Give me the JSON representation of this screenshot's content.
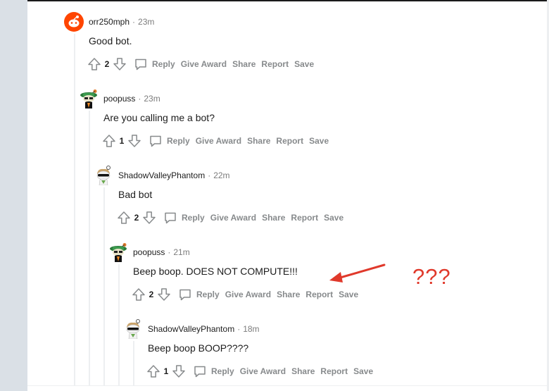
{
  "comments": [
    {
      "author": "orr250mph",
      "time": "23m",
      "body": "Good bot.",
      "score": "2"
    },
    {
      "author": "poopuss",
      "time": "23m",
      "body": "Are you calling me a bot?",
      "score": "1"
    },
    {
      "author": "ShadowValleyPhantom",
      "time": "22m",
      "body": "Bad bot",
      "score": "2"
    },
    {
      "author": "poopuss",
      "time": "21m",
      "body": "Beep boop. DOES NOT COMPUTE!!!",
      "score": "2"
    },
    {
      "author": "ShadowValleyPhantom",
      "time": "18m",
      "body": "Beep boop BOOP????",
      "score": "1"
    }
  ],
  "actions": {
    "reply": "Reply",
    "give_award": "Give Award",
    "share": "Share",
    "report": "Report",
    "save": "Save"
  },
  "meta_separator": "·",
  "annotation": {
    "text": "???",
    "color": "#e0392b"
  },
  "colors": {
    "gutter": "#dae0e6",
    "thread_line": "#edeff1",
    "action_text": "#878a8c",
    "meta_text": "#7c7c7c",
    "reddit_orange": "#ff4500"
  }
}
